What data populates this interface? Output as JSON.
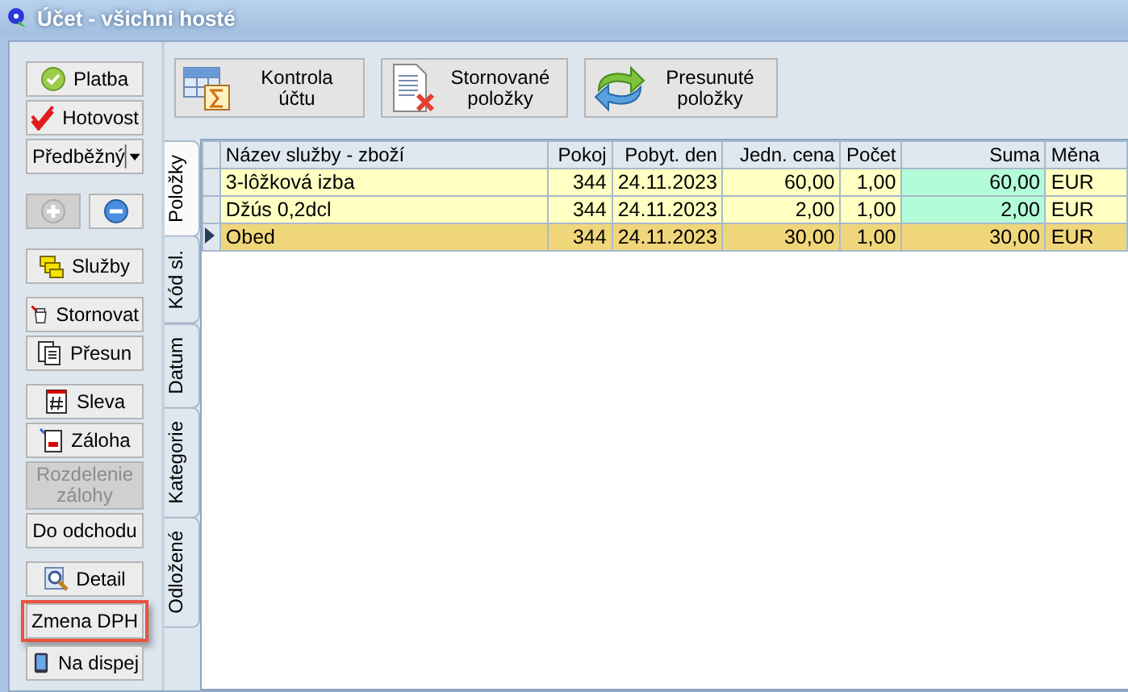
{
  "window": {
    "title": "Účet - všichni hosté"
  },
  "sidebar": {
    "groups": [
      [
        {
          "kind": "button",
          "label": "Platba",
          "disabled": false,
          "highlighted": false
        },
        {
          "kind": "button",
          "label": "Hotovost",
          "disabled": false,
          "highlighted": false
        },
        {
          "kind": "dropdown",
          "label": "Předběžný",
          "disabled": false
        }
      ],
      [
        {
          "kind": "icon",
          "disabled": true
        },
        {
          "kind": "icon",
          "disabled": false
        }
      ],
      [
        {
          "kind": "button",
          "label": "Služby",
          "disabled": false,
          "highlighted": false
        }
      ],
      [
        {
          "kind": "button",
          "label": "Stornovat",
          "disabled": false,
          "highlighted": false
        },
        {
          "kind": "button",
          "label": "Přesun",
          "disabled": false,
          "highlighted": false
        }
      ],
      [
        {
          "kind": "button",
          "label": "Sleva",
          "disabled": false,
          "highlighted": false
        },
        {
          "kind": "button",
          "label": "Záloha",
          "disabled": false,
          "highlighted": false
        },
        {
          "kind": "button",
          "label": "Rozdelenie zálohy",
          "disabled": true,
          "highlighted": false
        },
        {
          "kind": "button",
          "label": "Do odchodu",
          "disabled": false,
          "highlighted": false
        }
      ],
      [
        {
          "kind": "button",
          "label": "Detail",
          "disabled": false,
          "highlighted": false
        },
        {
          "kind": "button",
          "label": "Zmena DPH",
          "disabled": false,
          "highlighted": true
        },
        {
          "kind": "button",
          "label": "Na dispej",
          "disabled": false,
          "highlighted": false
        }
      ]
    ]
  },
  "toolbar": [
    {
      "label": "Kontrola účtu"
    },
    {
      "label": "Stornované položky"
    },
    {
      "label": "Presunuté položky"
    }
  ],
  "tabs": [
    {
      "label": "Položky",
      "selected": true
    },
    {
      "label": "Kód sl.",
      "selected": false
    },
    {
      "label": "Datum",
      "selected": false
    },
    {
      "label": "Kategorie",
      "selected": false
    },
    {
      "label": "Odložené",
      "selected": false
    }
  ],
  "table": {
    "columns": [
      "Název služby - zboží",
      "Pokoj",
      "Pobyt. den",
      "Jedn. cena",
      "Počet",
      "Suma",
      "Měna"
    ],
    "rows": [
      {
        "selected": false,
        "cells": [
          "3-lôžková izba",
          "344",
          "24.11.2023",
          "60,00",
          "1,00",
          "60,00",
          "EUR"
        ]
      },
      {
        "selected": false,
        "cells": [
          "Džús 0,2dcl",
          "344",
          "24.11.2023",
          "2,00",
          "1,00",
          "2,00",
          "EUR"
        ]
      },
      {
        "selected": true,
        "cells": [
          "Obed",
          "344",
          "24.11.2023",
          "30,00",
          "1,00",
          "30,00",
          "EUR"
        ]
      }
    ]
  }
}
